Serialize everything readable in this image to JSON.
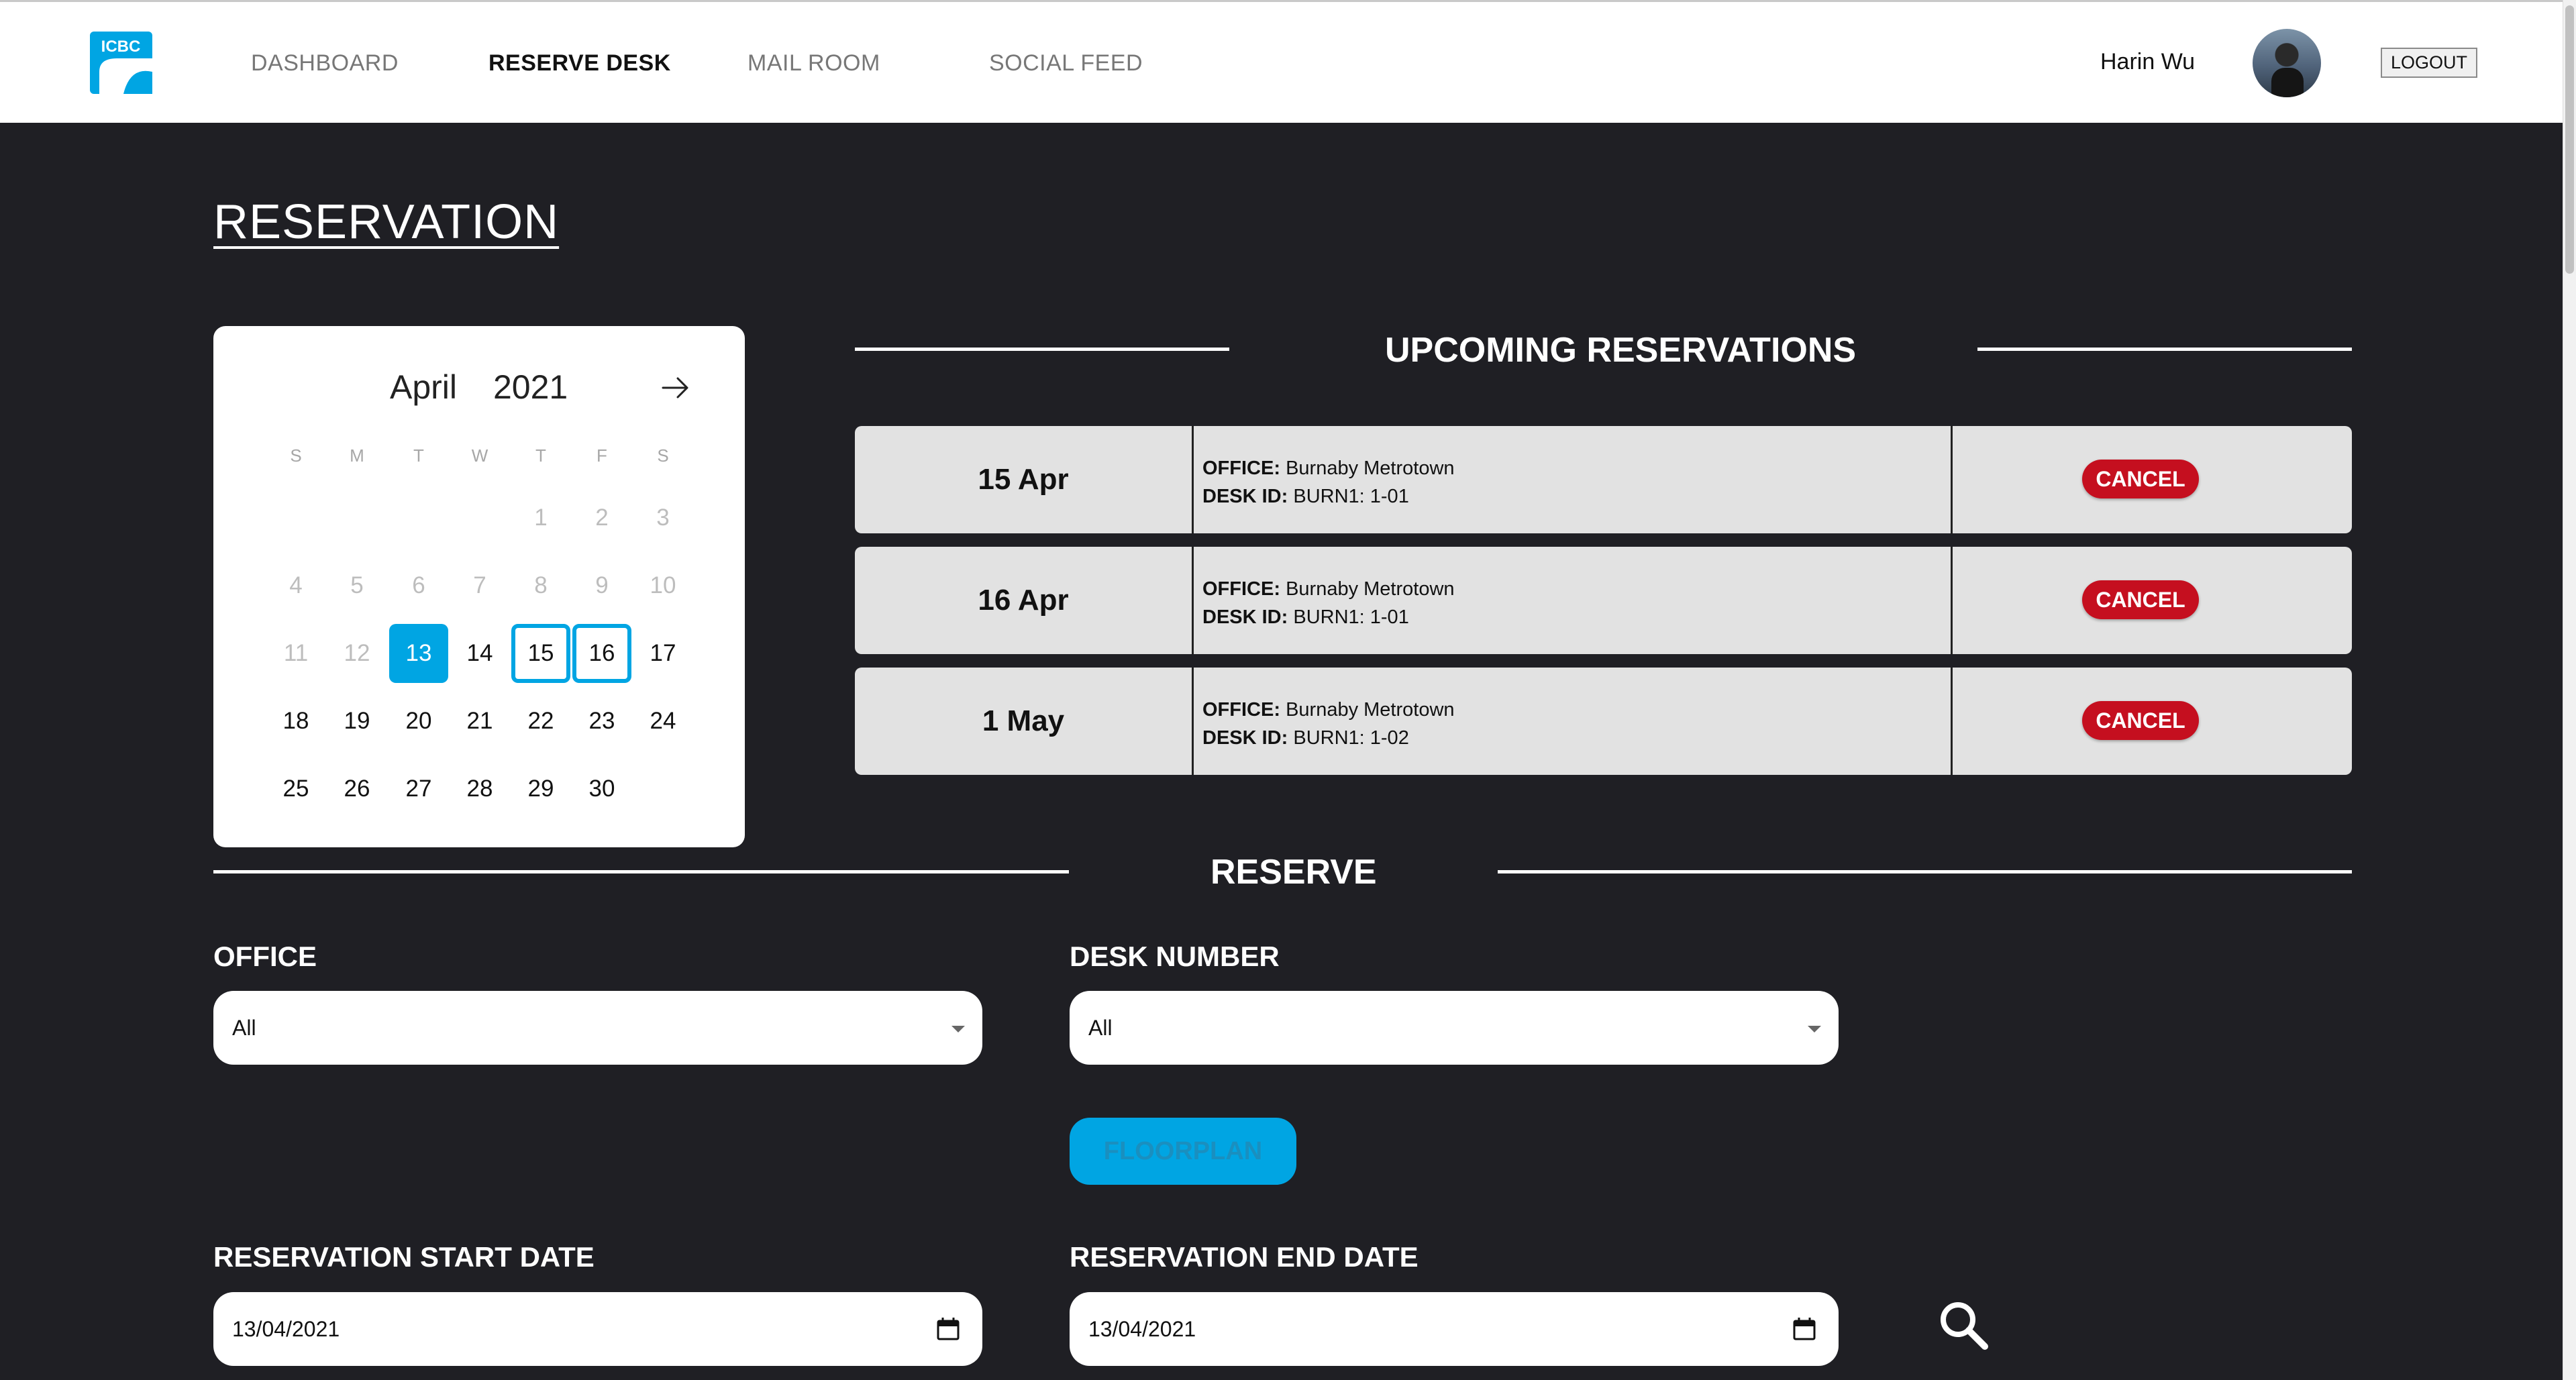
{
  "nav": {
    "logo_text": "ICBC",
    "items": [
      {
        "label": "DASHBOARD",
        "active": false
      },
      {
        "label": "RESERVE DESK",
        "active": true
      },
      {
        "label": "MAIL ROOM",
        "active": false
      },
      {
        "label": "SOCIAL FEED",
        "active": false
      }
    ],
    "user_name": "Harin Wu",
    "logout_label": "LOGOUT"
  },
  "page_title": "RESERVATION",
  "calendar": {
    "month": "April",
    "year": "2021",
    "weekdays": [
      "S",
      "M",
      "T",
      "W",
      "T",
      "F",
      "S"
    ],
    "weeks": [
      [
        "",
        "",
        "",
        "",
        "1",
        "2",
        "3"
      ],
      [
        "4",
        "5",
        "6",
        "7",
        "8",
        "9",
        "10"
      ],
      [
        "11",
        "12",
        "13",
        "14",
        "15",
        "16",
        "17"
      ],
      [
        "18",
        "19",
        "20",
        "21",
        "22",
        "23",
        "24"
      ],
      [
        "25",
        "26",
        "27",
        "28",
        "29",
        "30",
        ""
      ]
    ],
    "selected_day": "13",
    "reserved_days": [
      "15",
      "16"
    ]
  },
  "upcoming": {
    "title": "UPCOMING RESERVATIONS",
    "office_label": "OFFICE:",
    "desk_label": "DESK ID:",
    "cancel_label": "CANCEL",
    "rows": [
      {
        "date": "15 Apr",
        "office": "Burnaby Metrotown",
        "desk": "BURN1: 1-01"
      },
      {
        "date": "16 Apr",
        "office": "Burnaby Metrotown",
        "desk": "BURN1: 1-01"
      },
      {
        "date": "1 May",
        "office": "Burnaby Metrotown",
        "desk": "BURN1: 1-02"
      }
    ]
  },
  "reserve": {
    "title": "RESERVE",
    "office_label": "OFFICE",
    "office_value": "All",
    "desk_label": "DESK NUMBER",
    "desk_value": "All",
    "floorplan_label": "FLOORPLAN",
    "start_label": "RESERVATION START DATE",
    "start_value": "13/04/2021",
    "end_label": "RESERVATION END DATE",
    "end_value": "13/04/2021"
  },
  "colors": {
    "accent": "#00a5e3",
    "danger": "#c50f1f",
    "background": "#1f1f24"
  }
}
